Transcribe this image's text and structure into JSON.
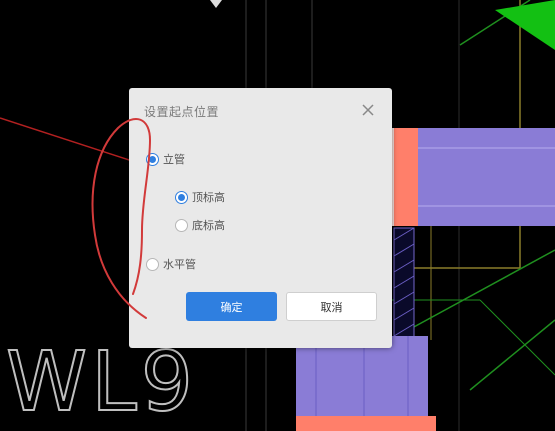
{
  "dialog": {
    "title": "设置起点位置",
    "options": {
      "vertical": {
        "label": "立管",
        "checked": true
      },
      "top_elevation": {
        "label": "顶标高",
        "checked": true
      },
      "bottom_elevation": {
        "label": "底标高",
        "checked": false
      },
      "horizontal": {
        "label": "水平管",
        "checked": false
      }
    },
    "ok_label": "确定",
    "cancel_label": "取消"
  },
  "cad": {
    "drawing_text": "WL9"
  },
  "colors": {
    "background": "#000000",
    "accent": "#2f7fe0",
    "annotation": "#d23a3a"
  }
}
